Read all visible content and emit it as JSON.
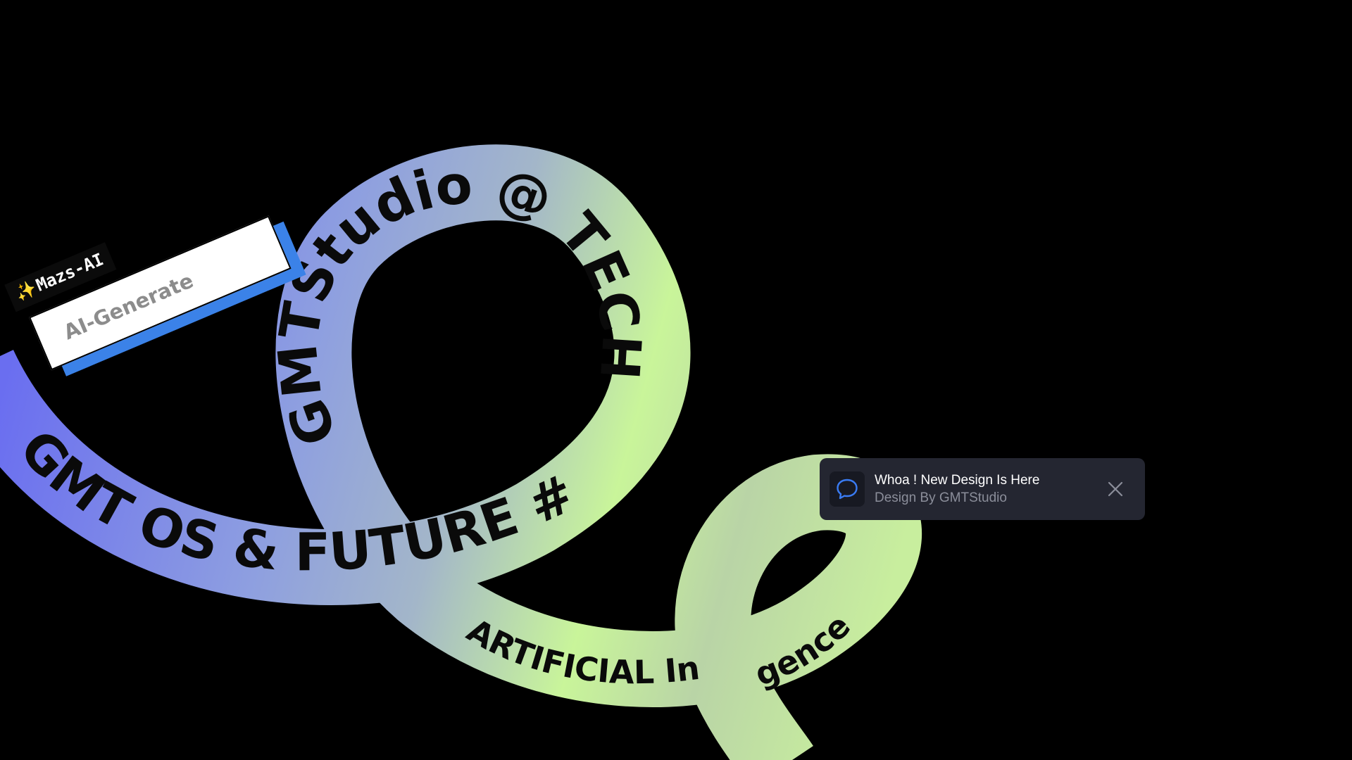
{
  "ribbon": {
    "loop_text": "GMTStudio @ TECH",
    "lower_text": "GMT OS  & FUTURE #",
    "tail_text": "ARTIFICIAL  Int",
    "tail_end_text": "gence",
    "colors": {
      "violet": "#6a6ef0",
      "periwinkle": "#8e9fe0",
      "blue_gray": "#9eb2c8",
      "lime": "#c9f59a",
      "sage": "#b9d4a6"
    }
  },
  "tag": {
    "spark_icon": "✨",
    "label": "Mazs-AI"
  },
  "ai_input": {
    "text": "AI-Generate",
    "accent_color": "#3b82e8"
  },
  "toast": {
    "icon": "chat-bubble-icon",
    "title": "Whoa ! New Design Is Here",
    "subtitle": "Design By GMTStudio",
    "close_icon": "close-icon"
  }
}
